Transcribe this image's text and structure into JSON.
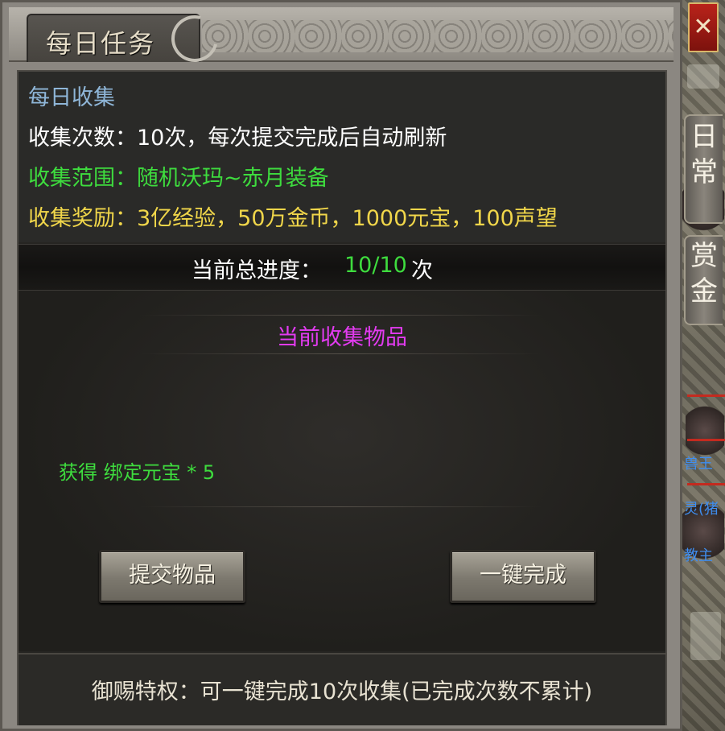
{
  "window": {
    "title": "每日任务"
  },
  "info": {
    "heading": "每日收集",
    "count_line": "收集次数：10次，每次提交完成后自动刷新",
    "range_line": "收集范围：随机沃玛~赤月装备",
    "reward_line": "收集奖励：3亿经验，50万金币，1000元宝，100声望"
  },
  "progress": {
    "label": "当前总进度：",
    "value": "10/10",
    "unit": "次"
  },
  "items": {
    "title": "当前收集物品",
    "reward": "获得 绑定元宝 * 5"
  },
  "buttons": {
    "submit": "提交物品",
    "one_click": "一键完成"
  },
  "footer": {
    "text": "御赐特权：可一键完成10次收集(已完成次数不累计)"
  },
  "side_tabs": {
    "daily": [
      "日",
      "常"
    ],
    "bounty": [
      "赏",
      "金"
    ]
  },
  "close_icon": "close-x",
  "background_labels": [
    "兽王",
    "灵(猪",
    "教主"
  ],
  "colors": {
    "heading": "#8fb6d8",
    "white_text": "#ffffff",
    "green": "#3edc3e",
    "yellow": "#f0d64a",
    "magenta": "#e23bf0",
    "close_red": "#b9231a",
    "npc_blue": "#3f8ef0"
  }
}
